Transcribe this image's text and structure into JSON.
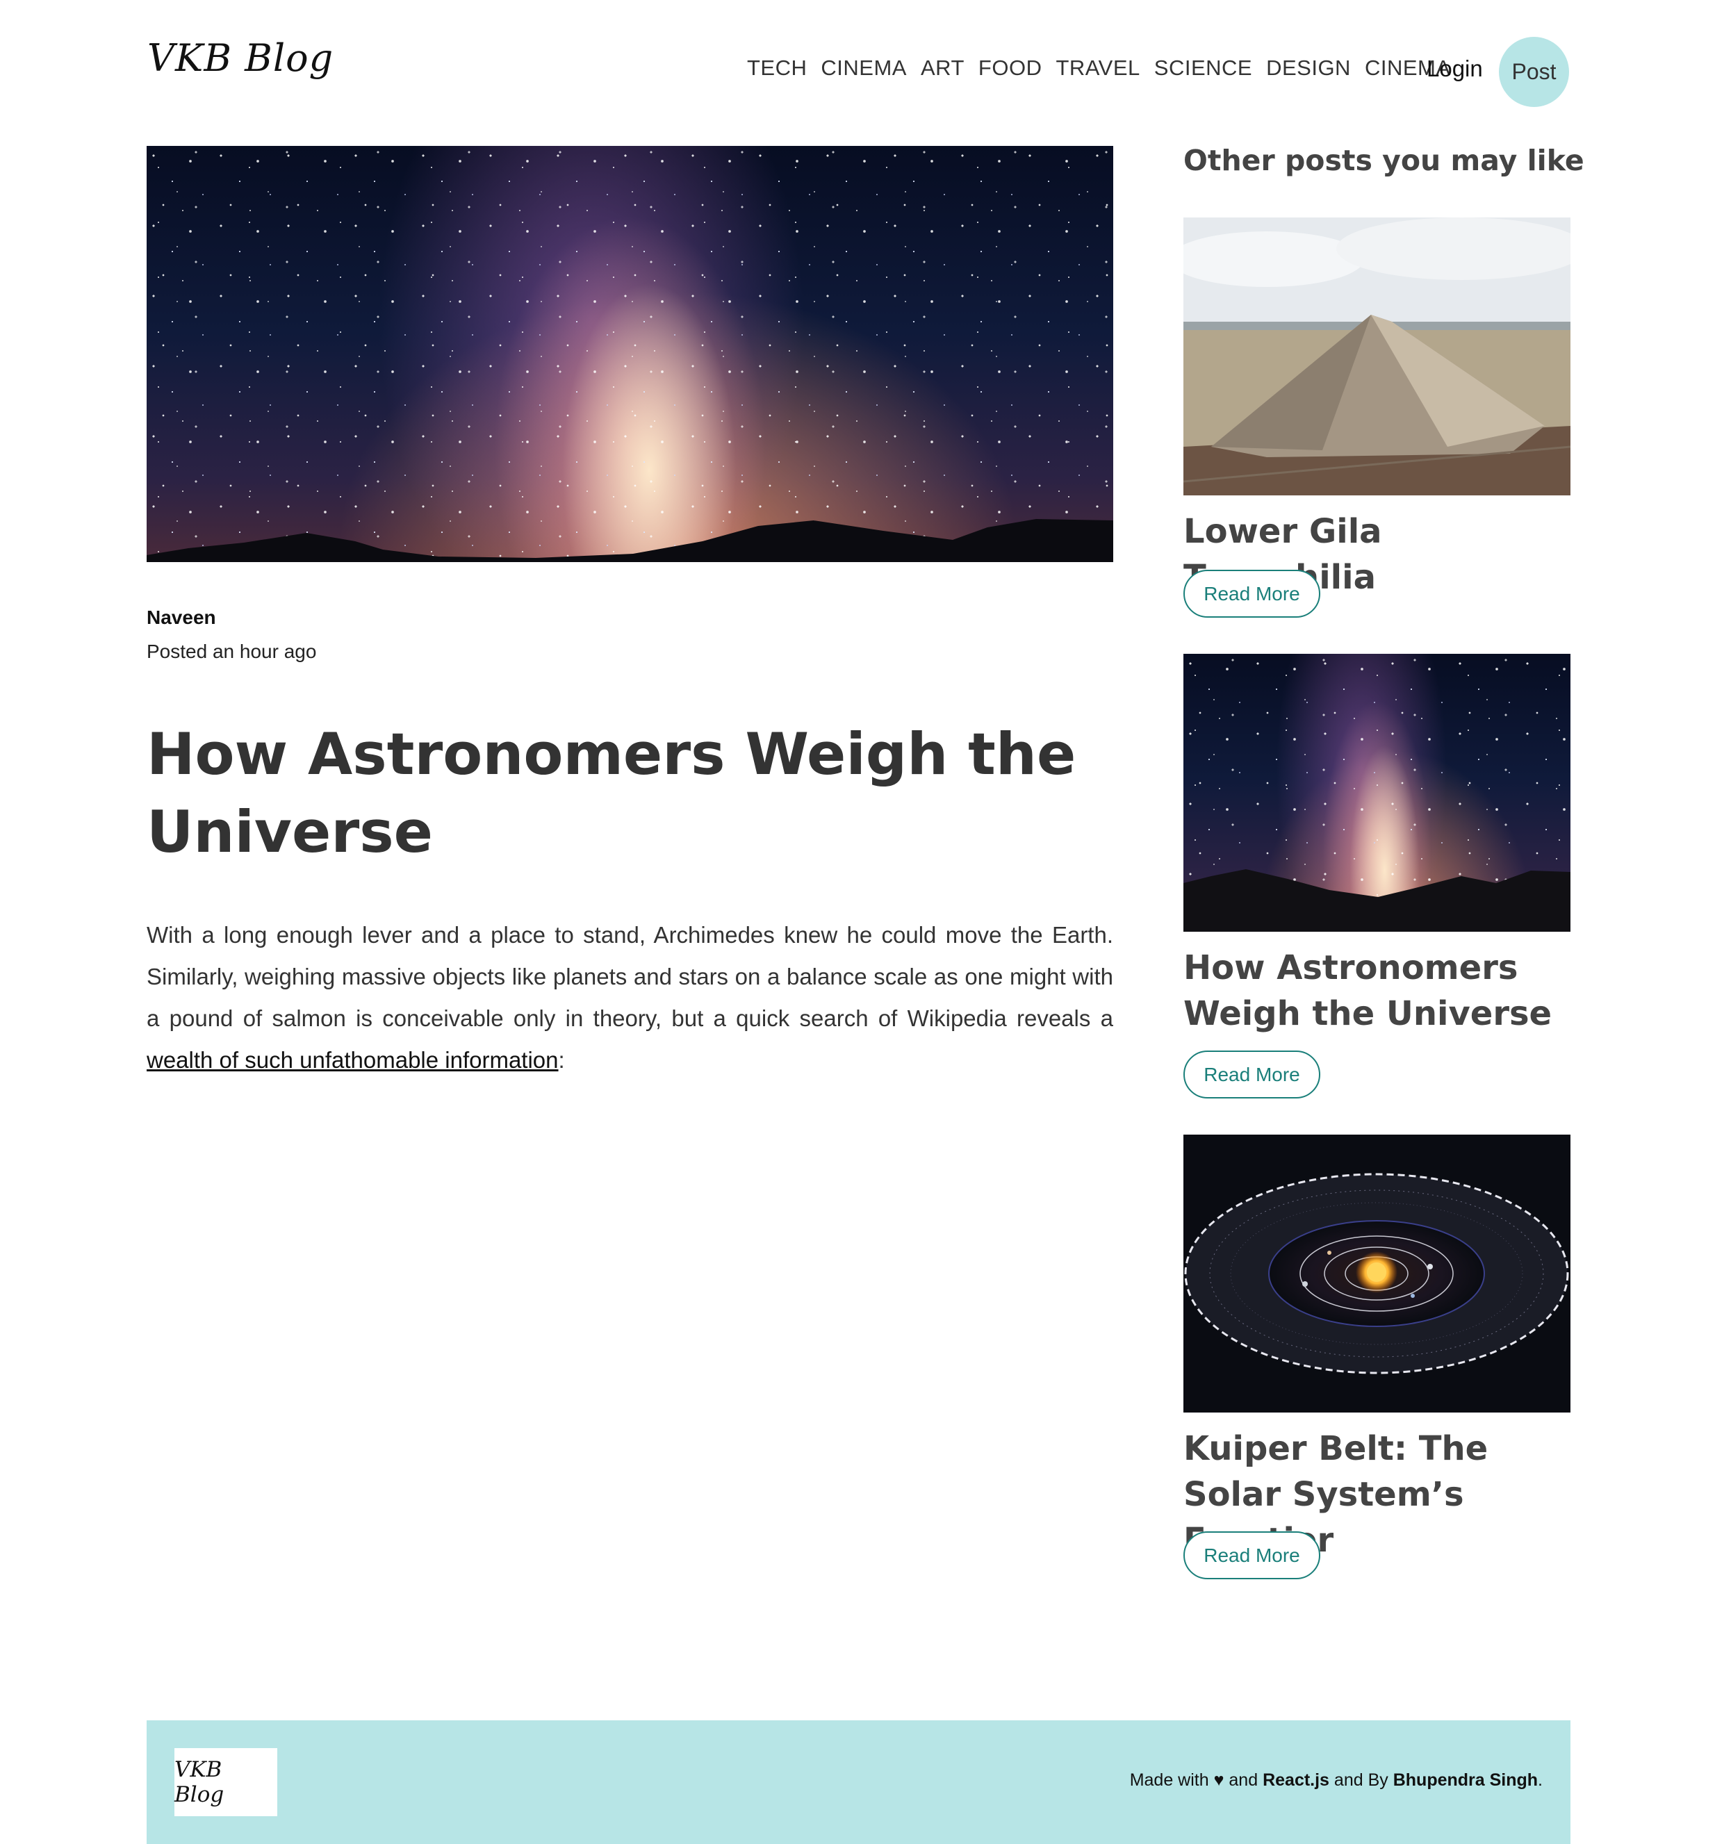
{
  "header": {
    "logo": "VKB Blog",
    "nav": [
      "TECH",
      "CINEMA",
      "ART",
      "FOOD",
      "TRAVEL",
      "SCIENCE",
      "DESIGN",
      "CINEMA"
    ],
    "login": "Login",
    "post": "Post"
  },
  "article": {
    "author": "Naveen",
    "posted": "Posted an hour ago",
    "title": "How Astronomers Weigh the Universe",
    "body_before": "With a long enough lever and a place to stand, Archimedes knew he could move the Earth. Similarly, weighing massive objects like planets and stars on a balance scale as one might with a pound of salmon is conceivable only in theory, but a quick search of Wikipedia reveals a ",
    "body_link": "wealth of such unfathomable information",
    "body_after": ":"
  },
  "sidebar": {
    "heading": "Other posts you may like",
    "cards": [
      {
        "title": "Lower Gila Topophilia",
        "button": "Read More"
      },
      {
        "title": "How Astronomers Weigh the Universe",
        "button": "Read More"
      },
      {
        "title": "Kuiper Belt: The Solar System’s Frontier",
        "button": "Read More"
      }
    ]
  },
  "footer": {
    "logo": "VKB Blog",
    "made_with": "Made with",
    "heart": "♥",
    "and1": "and",
    "react": "React.js",
    "and_by": "and By",
    "author": "Bhupendra Singh",
    "period": "."
  },
  "colors": {
    "accent": "#b7e5e6",
    "button_text": "#1a7f7a",
    "heading": "#444444"
  }
}
